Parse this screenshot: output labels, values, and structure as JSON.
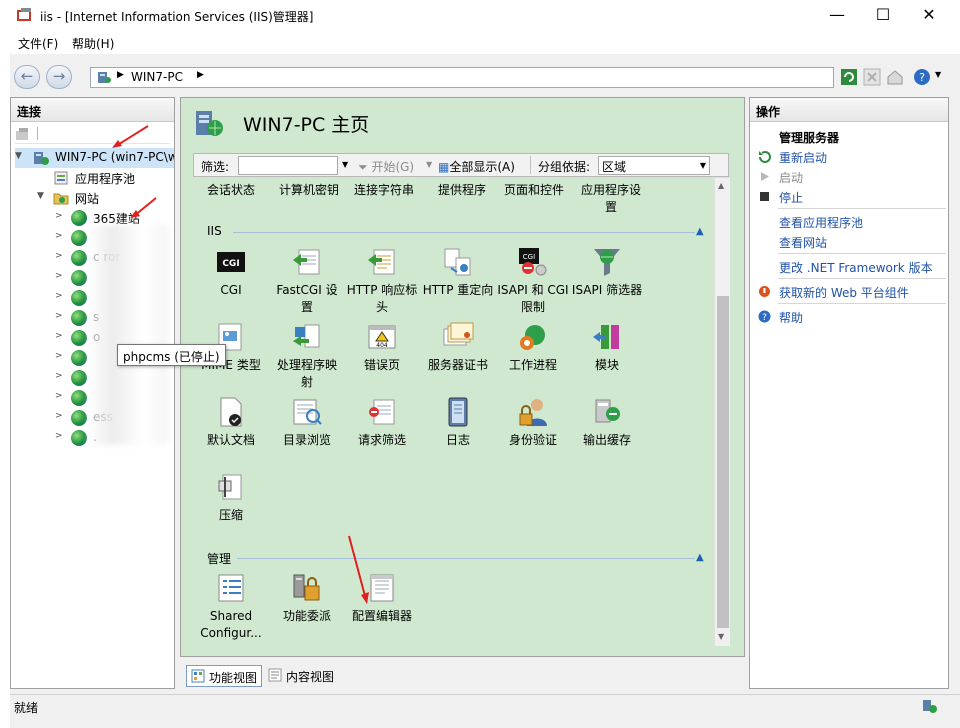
{
  "window": {
    "title": "iis - [Internet Information Services (IIS)管理器]"
  },
  "menu": [
    "文件(F)",
    "帮助(H)"
  ],
  "address": {
    "crumb": "WIN7-PC"
  },
  "connections": {
    "header": "连接"
  },
  "tree": {
    "server": "WIN7-PC (win7-PC\\w",
    "app_pools": "应用程序池",
    "sites": "网站",
    "tooltip": "phpcms (已停止)",
    "site_items": [
      "365建站",
      "",
      "c           ror",
      "",
      "",
      "            s",
      "            o",
      "",
      "",
      "",
      "           ess",
      "               ."
    ]
  },
  "center": {
    "title": "WIN7-PC 主页"
  },
  "filterbar": {
    "filter_label": "筛选:",
    "start": "开始(G)",
    "show_all": "全部显示(A)",
    "group_by": "分组依据:",
    "group_value": "区域"
  },
  "top_row": [
    "会话状态",
    "计算机密钥",
    "连接字符串",
    "提供程序",
    "页面和控件",
    "应用程序设\n置"
  ],
  "sections": {
    "iis": "IIS",
    "manage": "管理"
  },
  "iis_features": [
    {
      "label": "CGI",
      "icon": "cgi-icon"
    },
    {
      "label": "FastCGI 设\n置",
      "icon": "fastcgi-icon"
    },
    {
      "label": "HTTP 响应标\n头",
      "icon": "http-headers-icon"
    },
    {
      "label": "HTTP 重定向",
      "icon": "http-redirect-icon"
    },
    {
      "label": "ISAPI 和 CGI\n限制",
      "icon": "isapi-cgi-icon"
    },
    {
      "label": "ISAPI 筛选器",
      "icon": "isapi-filter-icon"
    },
    {
      "label": "MIME 类型",
      "icon": "mime-icon"
    },
    {
      "label": "处理程序映\n射",
      "icon": "handler-mapping-icon"
    },
    {
      "label": "错误页",
      "icon": "error-page-icon"
    },
    {
      "label": "服务器证书",
      "icon": "certificate-icon"
    },
    {
      "label": "工作进程",
      "icon": "worker-process-icon"
    },
    {
      "label": "模块",
      "icon": "modules-icon"
    },
    {
      "label": "默认文档",
      "icon": "default-document-icon"
    },
    {
      "label": "目录浏览",
      "icon": "directory-browsing-icon"
    },
    {
      "label": "请求筛选",
      "icon": "request-filtering-icon"
    },
    {
      "label": "日志",
      "icon": "logging-icon"
    },
    {
      "label": "身份验证",
      "icon": "authentication-icon"
    },
    {
      "label": "输出缓存",
      "icon": "output-cache-icon"
    },
    {
      "label": "压缩",
      "icon": "compression-icon"
    }
  ],
  "manage_features": [
    {
      "label": "Shared\nConfigur...",
      "icon": "shared-config-icon"
    },
    {
      "label": "功能委派",
      "icon": "feature-delegation-icon"
    },
    {
      "label": "配置编辑器",
      "icon": "config-editor-icon"
    }
  ],
  "tabs": [
    "功能视图",
    "内容视图"
  ],
  "actions": {
    "header": "操作",
    "manage_server": "管理服务器",
    "restart": "重新启动",
    "start": "启动",
    "stop": "停止",
    "view_pools": "查看应用程序池",
    "view_sites": "查看网站",
    "change_net": "更改 .NET Framework 版本",
    "web_platform": "获取新的 Web 平台组件",
    "help": "帮助"
  },
  "status": "就绪"
}
